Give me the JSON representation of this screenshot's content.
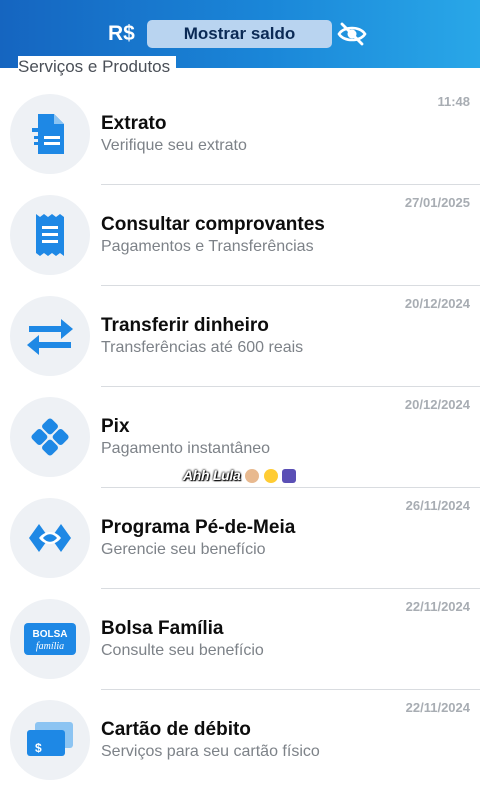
{
  "header": {
    "currency": "R$",
    "balance_button": "Mostrar saldo",
    "eye_icon": "eye-off-icon"
  },
  "section": {
    "title": "Serviços e Produtos"
  },
  "items": [
    {
      "title": "Extrato",
      "subtitle": "Verifique seu extrato",
      "time": "11:48",
      "icon": "document-icon"
    },
    {
      "title": "Consultar comprovantes",
      "subtitle": "Pagamentos e Transferências",
      "time": "27/01/2025",
      "icon": "receipt-icon"
    },
    {
      "title": "Transferir dinheiro",
      "subtitle": "Transferências até 600 reais",
      "time": "20/12/2024",
      "icon": "transfer-arrows-icon"
    },
    {
      "title": "Pix",
      "subtitle": "Pagamento instantâneo",
      "time": "20/12/2024",
      "icon": "pix-icon"
    },
    {
      "title": "Programa Pé-de-Meia",
      "subtitle": "Gerencie seu benefício",
      "time": "26/11/2024",
      "icon": "pe-de-meia-icon"
    },
    {
      "title": "Bolsa Família",
      "subtitle": "Consulte seu benefício",
      "time": "22/11/2024",
      "icon": "bolsa-familia-icon",
      "icon_text_1": "BOLSA",
      "icon_text_2": "família"
    },
    {
      "title": "Cartão de débito",
      "subtitle": "Serviços para seu cartão físico",
      "time": "22/11/2024",
      "icon": "debit-card-icon"
    }
  ],
  "sticker": {
    "text": "Ahh Lula"
  },
  "colors": {
    "brand_blue": "#1a86d8",
    "icon_blue": "#1e88e5",
    "icon_bg": "#eef1f5"
  }
}
